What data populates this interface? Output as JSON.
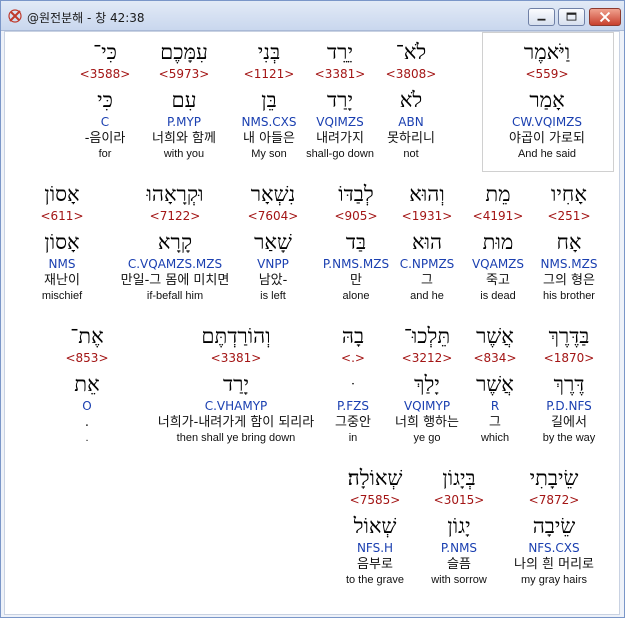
{
  "window": {
    "title": "@원전분해 - 창 42:38",
    "icon": "app-logo-icon",
    "controls": [
      "minimize-icon",
      "maximize-icon",
      "close-icon"
    ]
  },
  "rows": [
    [
      {
        "heb": "וַיֹּאמֶר",
        "strong": "<559>",
        "root": "אָמַר",
        "morph": "CW.VQIMZS",
        "kor": "야곱이 가로되",
        "eng": "And he said",
        "selected": true
      },
      {
        "heb": "לֹא־",
        "strong": "<3808>",
        "root": "לֹא",
        "morph": "ABN",
        "kor": "못하리니",
        "eng": "not"
      },
      {
        "heb": "יֵרֵד",
        "strong": "<3381>",
        "root": "יָרַד",
        "morph": "VQIMZS",
        "kor": "내려가지",
        "eng": "shall-go down"
      },
      {
        "heb": "בְּנִי",
        "strong": "<1121>",
        "root": "בֵּן",
        "morph": "NMS.CXS",
        "kor": "내 아들은",
        "eng": "My son"
      },
      {
        "heb": "עִמָּכֶם",
        "strong": "<5973>",
        "root": "עִם",
        "morph": "P.MYP",
        "kor": "너희와 함께",
        "eng": "with you"
      },
      {
        "heb": "כִּי־",
        "strong": "<3588>",
        "root": "כִּי",
        "morph": "C",
        "kor": "-음이라",
        "eng": "for"
      }
    ],
    [
      {
        "heb": "אָחִיו",
        "strong": "<251>",
        "root": "אָח",
        "morph": "NMS.MZS",
        "kor": "그의 형은",
        "eng": "his brother"
      },
      {
        "heb": "מֵת",
        "strong": "<4191>",
        "root": "מוּת",
        "morph": "VQAMZS",
        "kor": "죽고",
        "eng": "is dead"
      },
      {
        "heb": "וְהוּא",
        "strong": "<1931>",
        "root": "הוּא",
        "morph": "C.NPMZS",
        "kor": "그",
        "eng": "and he"
      },
      {
        "heb": "לְבַדּוֹ",
        "strong": "<905>",
        "root": "בַּד",
        "morph": "P.NMS.MZS",
        "kor": "만",
        "eng": "alone"
      },
      {
        "heb": "נִשְׁאָר",
        "strong": "<7604>",
        "root": "שָׁאַר",
        "morph": "VNPP",
        "kor": "남았-",
        "eng": "is left"
      },
      {
        "heb": "וּקְרָאָהוּ",
        "strong": "<7122>",
        "root": "קָרָא",
        "morph": "C.VQAMZS.MZS",
        "kor": "만일-그 몸에 미치면",
        "eng": "if-befall him"
      },
      {
        "heb": "אָסוֹן",
        "strong": "<611>",
        "root": "אָסוֹן",
        "morph": "NMS",
        "kor": "재난이",
        "eng": "mischief"
      }
    ],
    [
      {
        "heb": "בַּדֶּרֶךְ",
        "strong": "<1870>",
        "root": "דֶּרֶךְ",
        "morph": "P.D.NFS",
        "kor": "길에서",
        "eng": "by the way"
      },
      {
        "heb": "אֲשֶׁר",
        "strong": "<834>",
        "root": "אֲשֶׁר",
        "morph": "R",
        "kor": "그",
        "eng": "which"
      },
      {
        "heb": "תֵּלְכוּ־",
        "strong": "<3212>",
        "root": "יָלַךְ",
        "morph": "VQIMYP",
        "kor": "너희 행하는",
        "eng": "ye go"
      },
      {
        "heb": "בָהּ",
        "strong": "<.>",
        "root": "ּ",
        "morph": "P.FZS",
        "kor": "그중안",
        "eng": "in"
      },
      {
        "heb": "וְהוֹרַדְתֶּם",
        "strong": "<3381>",
        "root": "יָרַד",
        "morph": "C.VHAMYP",
        "kor": "너희가-내려가게 함이 되리라",
        "eng": "then shall ye bring down"
      },
      {
        "heb": "אֶת־",
        "strong": "<853>",
        "root": "אֵת",
        "morph": "O",
        "kor": ".",
        "eng": "."
      }
    ],
    [
      {
        "heb": "שֵׂיבָתִי",
        "strong": "<7872>",
        "root": "שֵׂיבָה",
        "morph": "NFS.CXS",
        "kor": "나의 흰 머리로",
        "eng": "my gray hairs"
      },
      {
        "heb": "בְּיָגוֹן",
        "strong": "<3015>",
        "root": "יָגוֹן",
        "morph": "P.NMS",
        "kor": "슬픔",
        "eng": "with sorrow"
      },
      {
        "heb": "שְׁאוֹלָה׃",
        "strong": "<7585>",
        "root": "שְׁאוֹל",
        "morph": "NFS.H",
        "kor": "음부로",
        "eng": "to the grave"
      }
    ]
  ]
}
